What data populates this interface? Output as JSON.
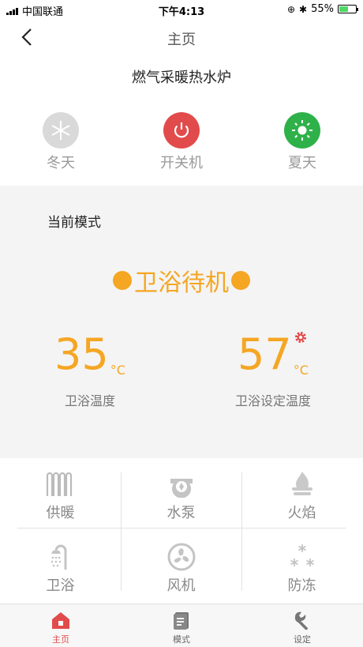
{
  "status_bar": {
    "carrier": "中国联通",
    "time": "下午4:13",
    "battery": "55%",
    "battery_level": 0.55
  },
  "nav": {
    "title": "主页"
  },
  "device": {
    "name": "燃气采暖热水炉"
  },
  "modes": [
    {
      "label": "冬天",
      "icon": "snowflake-icon",
      "color": "#d6d6d6"
    },
    {
      "label": "开关机",
      "icon": "power-icon",
      "color": "#e24b4b"
    },
    {
      "label": "夏天",
      "icon": "sun-icon",
      "color": "#2fb14a"
    }
  ],
  "panel": {
    "mode_caption": "当前模式",
    "status": "卫浴待机",
    "temps": [
      {
        "value": "35",
        "unit": "°C",
        "caption": "卫浴温度"
      },
      {
        "value": "57",
        "unit": "°C",
        "caption": "卫浴设定温度"
      }
    ]
  },
  "grid": [
    {
      "label": "供暖",
      "icon": "radiator-icon"
    },
    {
      "label": "水泵",
      "icon": "pump-icon"
    },
    {
      "label": "火焰",
      "icon": "flame-icon"
    },
    {
      "label": "卫浴",
      "icon": "shower-icon"
    },
    {
      "label": "风机",
      "icon": "fan-icon"
    },
    {
      "label": "防冻",
      "icon": "antifreeze-icon"
    }
  ],
  "tabbar": [
    {
      "label": "主页",
      "icon": "home-icon",
      "active": true
    },
    {
      "label": "模式",
      "icon": "mode-list-icon",
      "active": false
    },
    {
      "label": "设定",
      "icon": "wrench-icon",
      "active": false
    }
  ],
  "colors": {
    "accent": "#f5a623",
    "active_tab": "#e24b4b",
    "inactive_icon": "#bbbbbb"
  }
}
